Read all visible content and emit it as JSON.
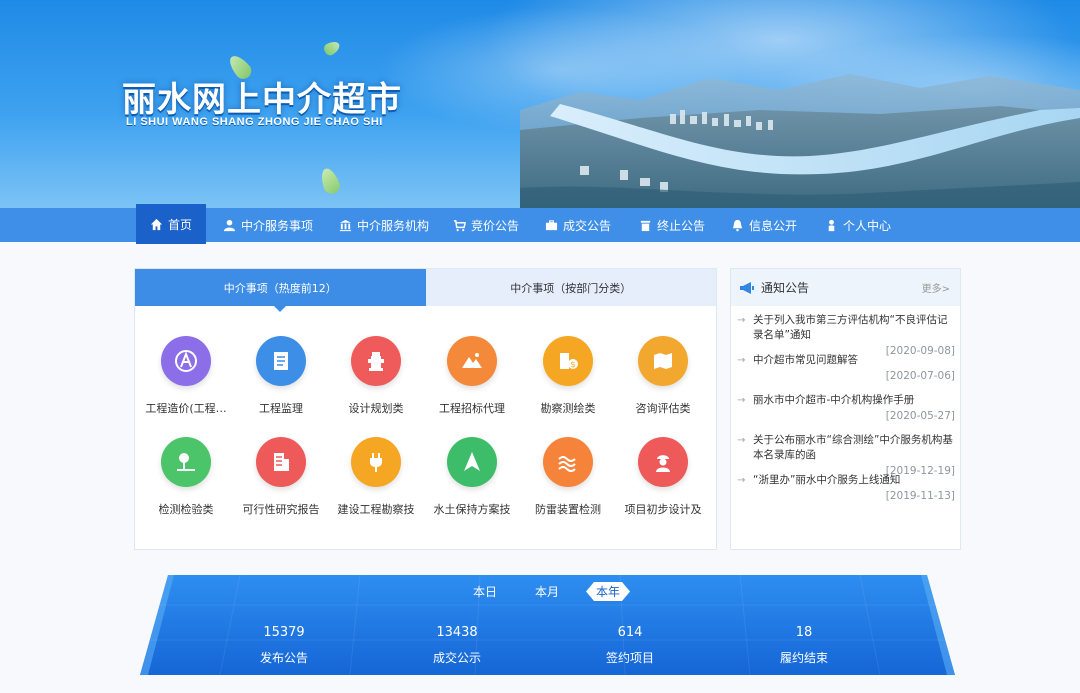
{
  "banner": {
    "title": "丽水网上中介超市",
    "subtitle": "LI SHUI  WANG  SHANG ZHONG JIE CHAO SHI"
  },
  "nav": {
    "items": [
      {
        "label": "首页",
        "icon": "home-icon",
        "active": true
      },
      {
        "label": "中介服务事项",
        "icon": "user-icon"
      },
      {
        "label": "中介服务机构",
        "icon": "bank-icon"
      },
      {
        "label": "竞价公告",
        "icon": "cart-icon"
      },
      {
        "label": "成交公告",
        "icon": "briefcase-icon"
      },
      {
        "label": "终止公告",
        "icon": "trash-icon"
      },
      {
        "label": "信息公开",
        "icon": "bell-icon"
      },
      {
        "label": "个人中心",
        "icon": "person-icon"
      }
    ]
  },
  "main": {
    "tabs": [
      "中介事项（热度前12）",
      "中介事项（按部门分类）"
    ],
    "services": [
      {
        "label": "工程造价(工程…",
        "icon": "compass-icon",
        "color": "#8b6ee8"
      },
      {
        "label": "工程监理",
        "icon": "document-icon",
        "color": "#3c8ee6"
      },
      {
        "label": "设计规划类",
        "icon": "hydrant-icon",
        "color": "#ef5b5b"
      },
      {
        "label": "工程招标代理",
        "icon": "mountain-icon",
        "color": "#f5893a"
      },
      {
        "label": "勘察测绘类",
        "icon": "building-money-icon",
        "color": "#f5a623"
      },
      {
        "label": "咨询评估类",
        "icon": "map-icon",
        "color": "#f2a72e"
      },
      {
        "label": "检测检验类",
        "icon": "tree-icon",
        "color": "#4cc46a"
      },
      {
        "label": "可行性研究报告",
        "icon": "office-building-icon",
        "color": "#ee5a5a"
      },
      {
        "label": "建设工程勘察技",
        "icon": "plug-icon",
        "color": "#f5a623"
      },
      {
        "label": "水土保持方案技",
        "icon": "navigation-icon",
        "color": "#3dbc6a"
      },
      {
        "label": "防雷装置检测",
        "icon": "waves-icon",
        "color": "#f5843a"
      },
      {
        "label": "项目初步设计及",
        "icon": "worker-icon",
        "color": "#ee5a5a"
      }
    ]
  },
  "notice": {
    "title": "通知公告",
    "more": "更多>",
    "items": [
      {
        "text": "关于列入我市第三方评估机构“不良评估记录名单”通知",
        "date": "[2020-09-08]"
      },
      {
        "text": "中介超市常见问题解答",
        "date": "[2020-07-06]"
      },
      {
        "text": "丽水市中介超市-中介机构操作手册",
        "date": "[2020-05-27]"
      },
      {
        "text": "关于公布丽水市“综合测绘”中介服务机构基本名录库的函",
        "date": "[2019-12-19]"
      },
      {
        "text": "“浙里办”丽水中介服务上线通知",
        "date": "[2019-11-13]"
      }
    ]
  },
  "stats": {
    "periods": [
      "本日",
      "本月",
      "本年"
    ],
    "active_period": "本年",
    "items": [
      {
        "value": "15379",
        "label": "发布公告"
      },
      {
        "value": "13438",
        "label": "成交公示"
      },
      {
        "value": "614",
        "label": "签约项目"
      },
      {
        "value": "18",
        "label": "履约结束"
      }
    ]
  }
}
